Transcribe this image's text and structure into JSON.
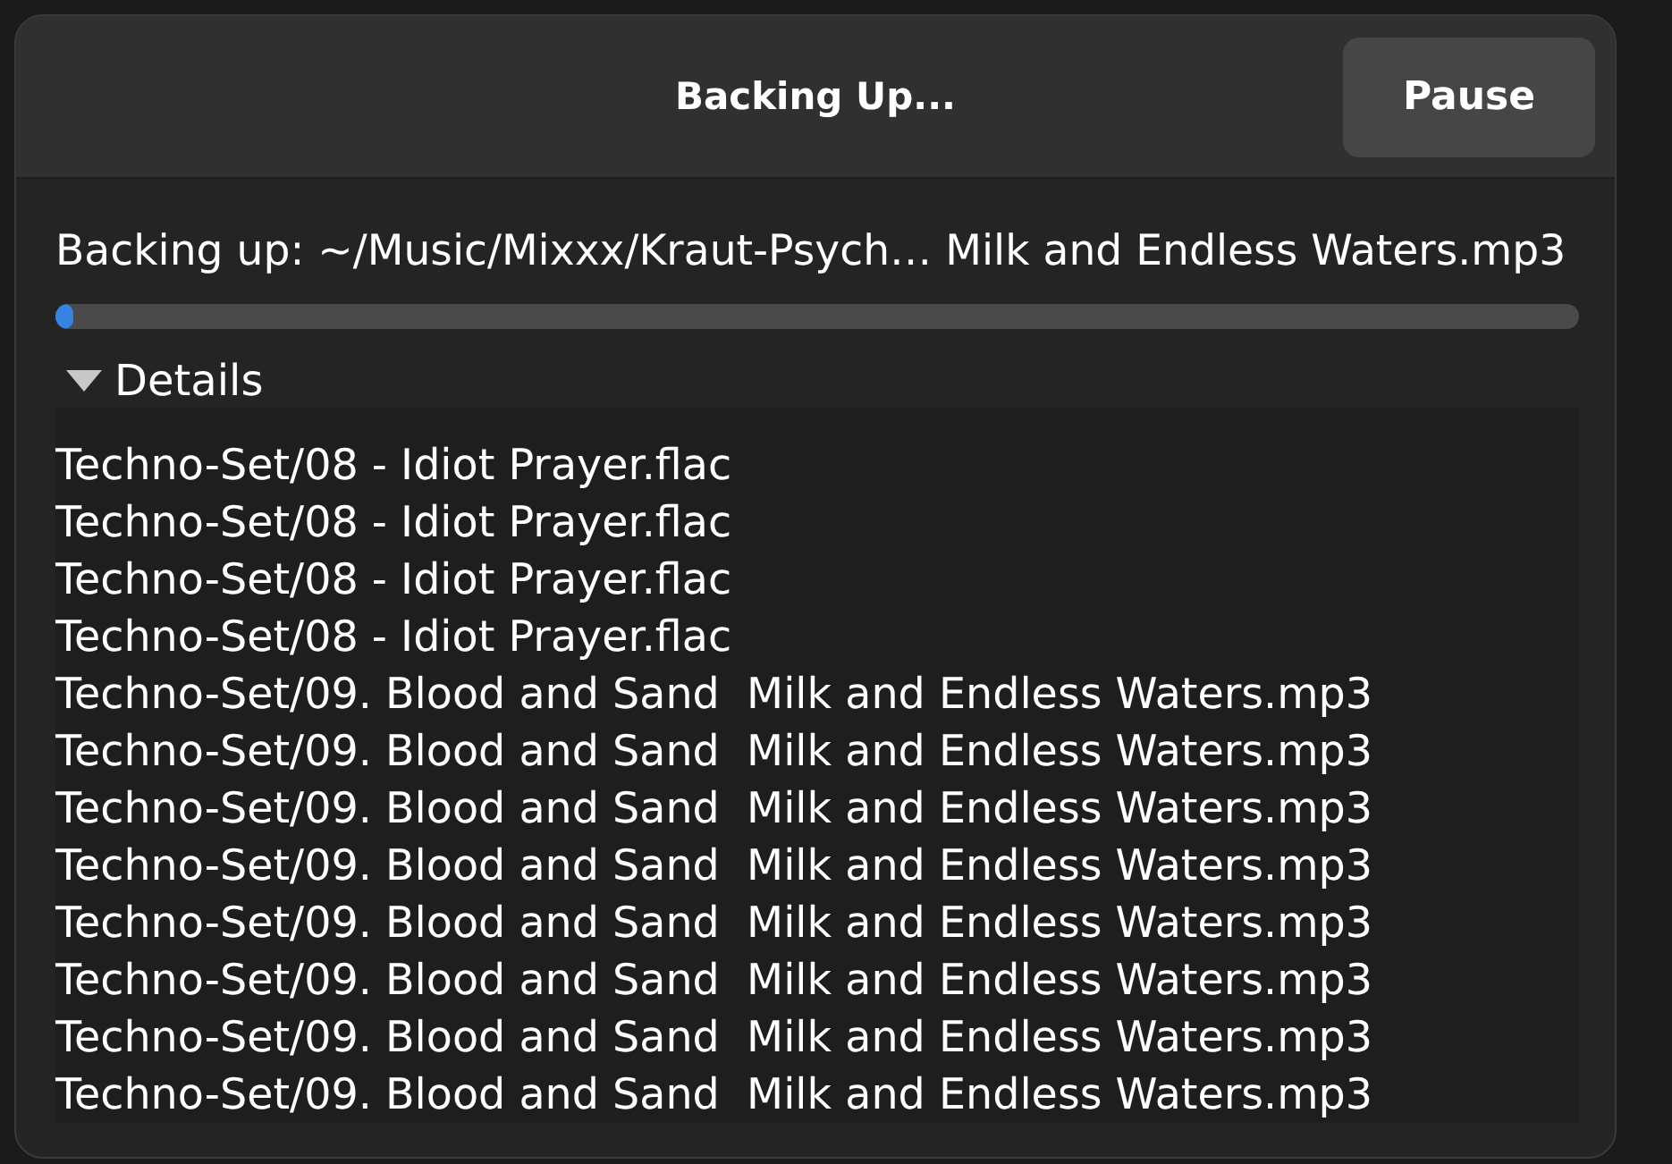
{
  "dialog": {
    "title": "Backing Up...",
    "pause_button": {
      "label": "Pause"
    },
    "status": "Backing up: ~/Music/Mixxx/Kraut-Psych… Milk and Endless Waters.mp3",
    "progress": {
      "level": 0.012
    },
    "details": {
      "label": "Details",
      "expanded": true,
      "log": [
        "Techno-Set/08 - Idiot Prayer.flac",
        "Techno-Set/08 - Idiot Prayer.flac",
        "Techno-Set/08 - Idiot Prayer.flac",
        "Techno-Set/08 - Idiot Prayer.flac",
        "Techno-Set/09. Blood and Sand  Milk and Endless Waters.mp3",
        "Techno-Set/09. Blood and Sand  Milk and Endless Waters.mp3",
        "Techno-Set/09. Blood and Sand  Milk and Endless Waters.mp3",
        "Techno-Set/09. Blood and Sand  Milk and Endless Waters.mp3",
        "Techno-Set/09. Blood and Sand  Milk and Endless Waters.mp3",
        "Techno-Set/09. Blood and Sand  Milk and Endless Waters.mp3",
        "Techno-Set/09. Blood and Sand  Milk and Endless Waters.mp3",
        "Techno-Set/09. Blood and Sand  Milk and Endless Waters.mp3"
      ]
    }
  }
}
